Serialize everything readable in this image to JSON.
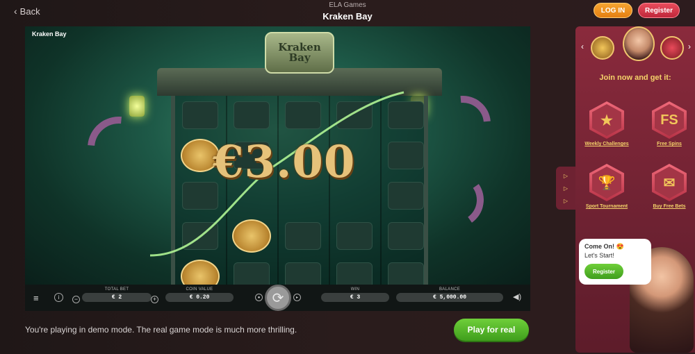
{
  "header": {
    "back_label": "Back",
    "brand": "ELA Games",
    "title": "Kraken Bay",
    "login_label": "LOG IN",
    "register_label": "Register"
  },
  "game": {
    "name": "Kraken Bay",
    "logo_text": "Kraken Bay",
    "win_amount": "€3.00"
  },
  "controls": {
    "total_bet_label": "TOTAL BET",
    "total_bet_value": "€ 2",
    "coin_value_label": "COIN VALUE",
    "coin_value_value": "€ 0.20",
    "win_label": "WIN",
    "win_value": "€ 3",
    "balance_label": "BALANCE",
    "balance_value": "€ 5,000.00",
    "minus": "−",
    "plus": "+",
    "info": "i",
    "menu_icon": "≡",
    "spin_icon": "⟳",
    "sound_icon": "◀)"
  },
  "demo": {
    "note": "You're playing in demo mode. The real game mode is much more thrilling.",
    "play_real_label": "Play for real"
  },
  "promo": {
    "join_text": "Join now and get it:",
    "features": [
      {
        "label": "Weekly Challenges",
        "glyph": "★"
      },
      {
        "label": "Free Spins",
        "glyph": "FS"
      },
      {
        "label": "Sport Tournament",
        "glyph": "🏆"
      },
      {
        "label": "Buy Free Bets",
        "glyph": "✉"
      }
    ],
    "side_tab_glyph": "▷"
  },
  "chat": {
    "line1": "Come On! 😍",
    "line2": "Let's Start!",
    "register_label": "Register"
  },
  "colors": {
    "accent_orange": "#f6a531",
    "accent_red": "#e94c5c",
    "accent_green": "#6fcf3a",
    "panel_bg": "#8a2a3c",
    "gold_text": "#f5d36a"
  }
}
